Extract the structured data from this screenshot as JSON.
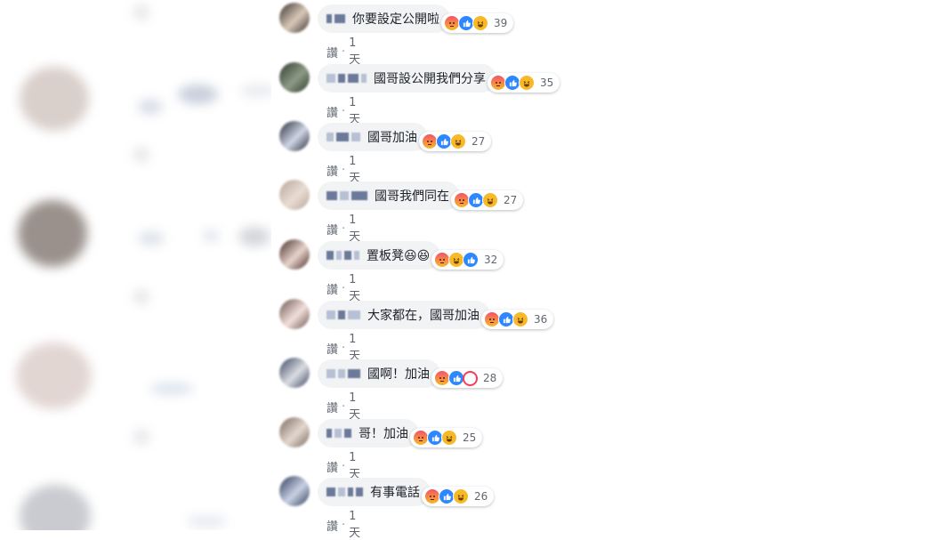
{
  "comments": [
    {
      "text": "你要設定公開啦",
      "reactions": [
        "angry",
        "like",
        "haha"
      ],
      "count": "39",
      "meta": "1天"
    },
    {
      "text": "國哥設公開我們分享",
      "reactions": [
        "angry",
        "like",
        "haha"
      ],
      "count": "35",
      "meta": "1天"
    },
    {
      "text": "國哥加油",
      "reactions": [
        "angry",
        "like",
        "haha"
      ],
      "count": "27",
      "meta": "1天"
    },
    {
      "text": "國哥我們同在",
      "reactions": [
        "angry",
        "like",
        "haha"
      ],
      "count": "27",
      "meta": "1天"
    },
    {
      "text": "置板凳😆😆",
      "reactions": [
        "angry",
        "haha",
        "like"
      ],
      "count": "32",
      "meta": "1天"
    },
    {
      "text": "大家都在，國哥加油",
      "reactions": [
        "angry",
        "like",
        "haha"
      ],
      "count": "36",
      "meta": "1天"
    },
    {
      "text": "國啊！加油",
      "reactions": [
        "angry",
        "like",
        "love"
      ],
      "count": "28",
      "meta": "1天"
    },
    {
      "text": "哥！加油",
      "reactions": [
        "angry",
        "like",
        "haha"
      ],
      "count": "25",
      "meta": "1天"
    },
    {
      "text": "有事電話",
      "reactions": [
        "angry",
        "like",
        "haha"
      ],
      "count": "26",
      "meta": "1天"
    }
  ],
  "action_label": "讚",
  "separator": "·",
  "colors": {
    "bubble": "#f2f3f5",
    "like": "#2d88ff",
    "text": "#1d2129",
    "meta": "#606770"
  }
}
